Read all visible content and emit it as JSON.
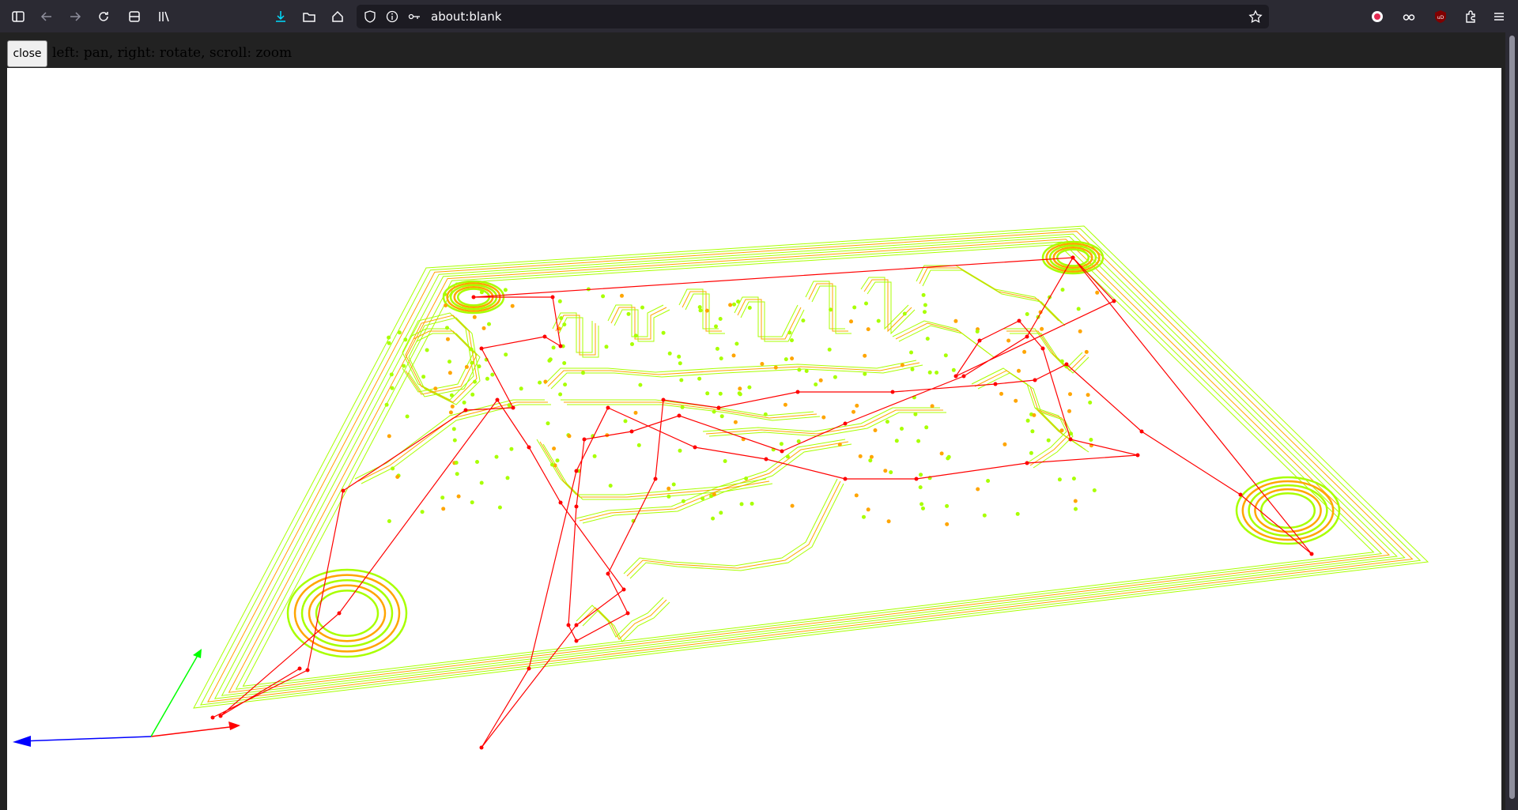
{
  "browser": {
    "url": "about:blank",
    "toolbar_icons": [
      "sidebar-icon",
      "back-icon",
      "forward-icon",
      "reload-icon",
      "pocket-icon",
      "library-icon",
      "download-icon",
      "folder-icon",
      "home-icon",
      "shield-icon",
      "info-icon",
      "permissions-icon",
      "bookmark-star-icon",
      "extension-icon",
      "privacy-icon",
      "ublock-icon",
      "puzzle-icon",
      "menu-icon"
    ],
    "accent_color": "#2b2a33"
  },
  "viewer": {
    "close_label": "close",
    "instructions": "left: pan, right: rotate, scroll: zoom",
    "colors": {
      "cut_path": "#a8ff00",
      "plunge_path": "#ffa500",
      "rapid_move": "#ff0000",
      "axis_x": "#ff0000",
      "axis_y": "#00ff00",
      "axis_z": "#0000ff"
    }
  }
}
